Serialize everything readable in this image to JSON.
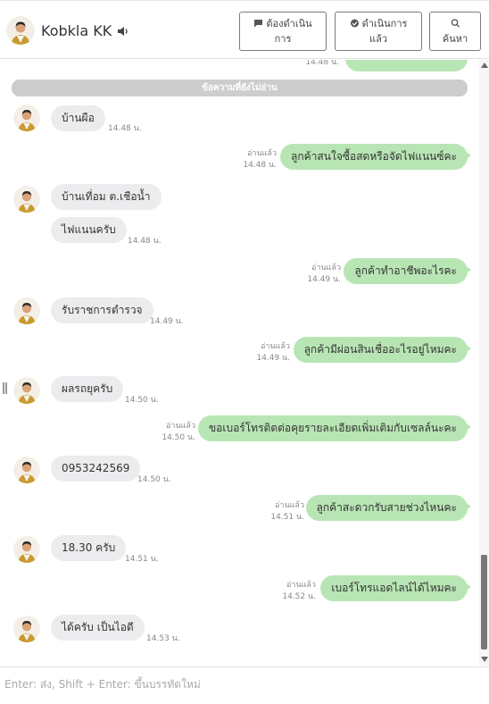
{
  "header": {
    "contact_name": "Kobkla KK",
    "buttons": {
      "todo_line1": "ต้องดำเนิน",
      "todo_line2": "การ",
      "done_line1": "ดำเนินการ",
      "done_line2": "แล้ว",
      "search": "ค้นหา"
    }
  },
  "chat": {
    "top_partial_time": "14.48 น.",
    "unread_divider": "ข้อความที่ยังไม่อ่าน",
    "messages": [
      {
        "dir": "in",
        "text": "บ้านผือ",
        "time": "14.48 น."
      },
      {
        "dir": "out",
        "text": "ลูกค้าสนใจซื้อสดหรือจัดไฟแนนซ์คะ",
        "read": "อ่านแล้ว",
        "time": "14.48 น."
      },
      {
        "dir": "in",
        "text": "บ้านเที่อม ต.เชือน้ำ",
        "time": ""
      },
      {
        "dir": "in",
        "text": "ไฟแนนครับ",
        "time": "14.48 น."
      },
      {
        "dir": "out",
        "text": "ลูกค้าทำอาชีพอะไรคะ",
        "read": "อ่านแล้ว",
        "time": "14.49 น."
      },
      {
        "dir": "in",
        "text": "รับราชการตำรวจ",
        "time": "14.49 น."
      },
      {
        "dir": "out",
        "text": "ลูกค้ามีผ่อนสินเชื่ออะไรอยู่ไหมคะ",
        "read": "อ่านแล้ว",
        "time": "14.49 น."
      },
      {
        "dir": "in",
        "text": "ผลรถยุครับ",
        "time": "14.50 น."
      },
      {
        "dir": "out",
        "text": "ขอเบอร์โทรติดต่อคุยรายละเอียดเพิ่มเติมกับเซลล์นะคะ",
        "read": "อ่านแล้ว",
        "time": "14.50 น."
      },
      {
        "dir": "in",
        "text": "0953242569",
        "time": "14.50 น."
      },
      {
        "dir": "out",
        "text": "ลูกค้าสะดวกรับสายช่วงไหนคะ",
        "read": "อ่านแล้ว",
        "time": "14.51 น."
      },
      {
        "dir": "in",
        "text": "18.30 ครับ",
        "time": "14.51 น."
      },
      {
        "dir": "out",
        "text": "เบอร์โทรแอดไลน์ได้ไหมคะ",
        "read": "อ่านแล้ว",
        "time": "14.52 น."
      },
      {
        "dir": "in",
        "text": "ได้ครับ เป็นไอดี",
        "time": "14.53 น."
      }
    ]
  },
  "composer": {
    "placeholder": "Enter: ส่ง, Shift + Enter: ขึ้นบรรทัดใหม่"
  },
  "colors": {
    "outgoing_bubble": "#b8e5b4",
    "incoming_bubble": "#ececee",
    "unread_divider": "#cdcdcd"
  }
}
